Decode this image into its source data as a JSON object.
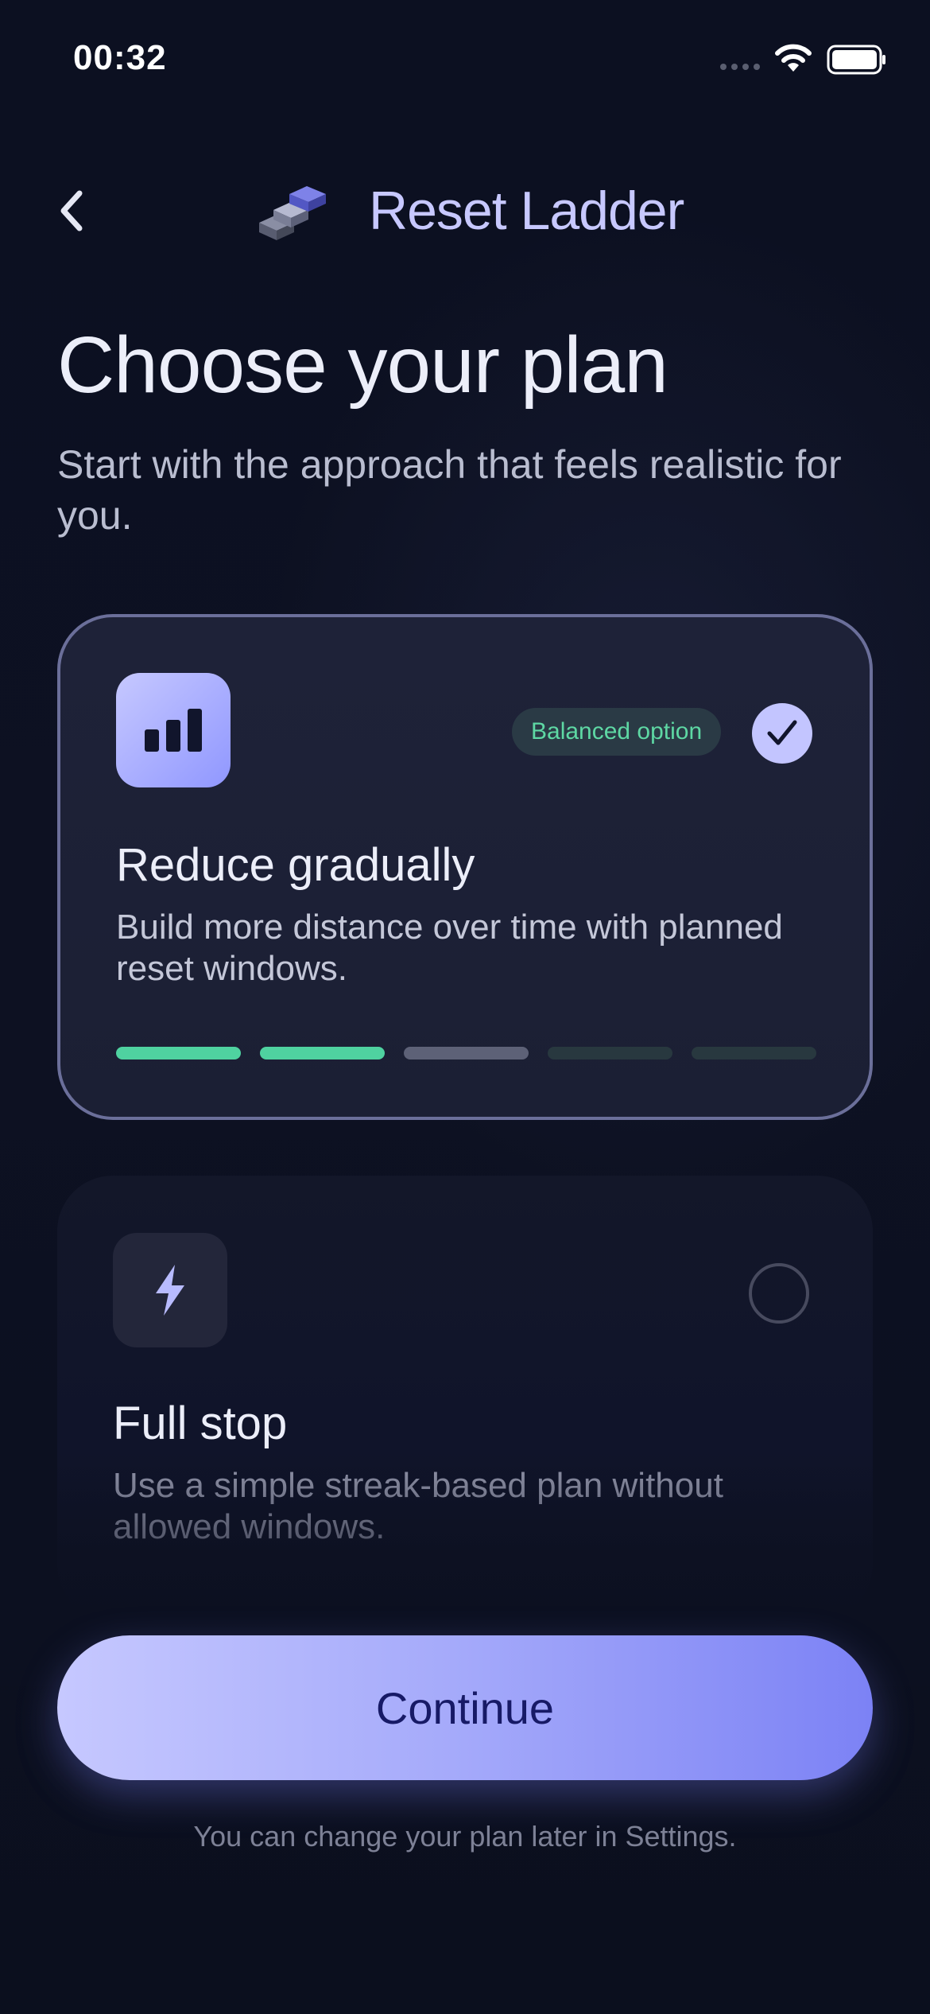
{
  "status_bar": {
    "time": "00:32",
    "wifi_icon": "wifi-icon",
    "battery_icon": "battery-icon"
  },
  "header": {
    "back_icon": "chevron-left-icon",
    "logo_icon": "stacked-steps-logo",
    "app_title": "Reset Ladder"
  },
  "page": {
    "title": "Choose your plan",
    "subtitle": "Start with the approach that feels realistic for you."
  },
  "plans": [
    {
      "icon": "bar-chart-icon",
      "badge": "Balanced option",
      "name": "Reduce gradually",
      "description": "Build more distance over time with planned reset windows.",
      "selected": true,
      "progress_segments": [
        "active",
        "active",
        "neutral",
        "dim",
        "dim"
      ]
    },
    {
      "icon": "lightning-bolt-icon",
      "name": "Full stop",
      "description": "Use a simple streak-based plan without allowed windows.",
      "selected": false
    }
  ],
  "actions": {
    "continue_label": "Continue"
  },
  "footer": {
    "note": "You can change your plan later in Settings."
  },
  "colors": {
    "background": "#0c1020",
    "accent": "#9097ff",
    "badge_text": "#5ed8a4",
    "progress_active": "#4fd2a0",
    "progress_neutral": "#5d6177",
    "progress_dim": "#28383f"
  }
}
